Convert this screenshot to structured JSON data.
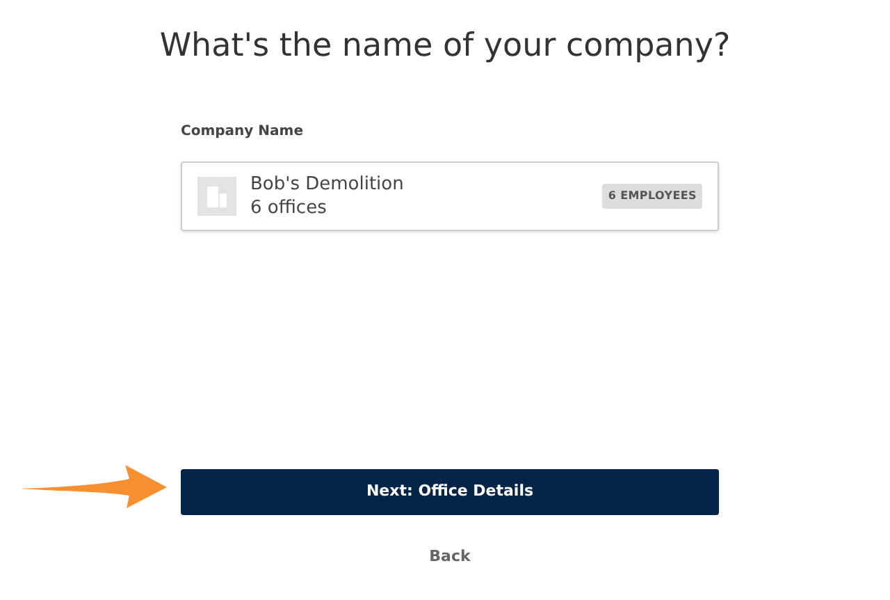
{
  "heading": "What's the name of your company?",
  "field": {
    "label": "Company Name",
    "company": "Bob's Demolition",
    "offices": "6 offices",
    "badge": "6 EMPLOYEES"
  },
  "next_button": "Next: Office Details",
  "back_link": "Back"
}
